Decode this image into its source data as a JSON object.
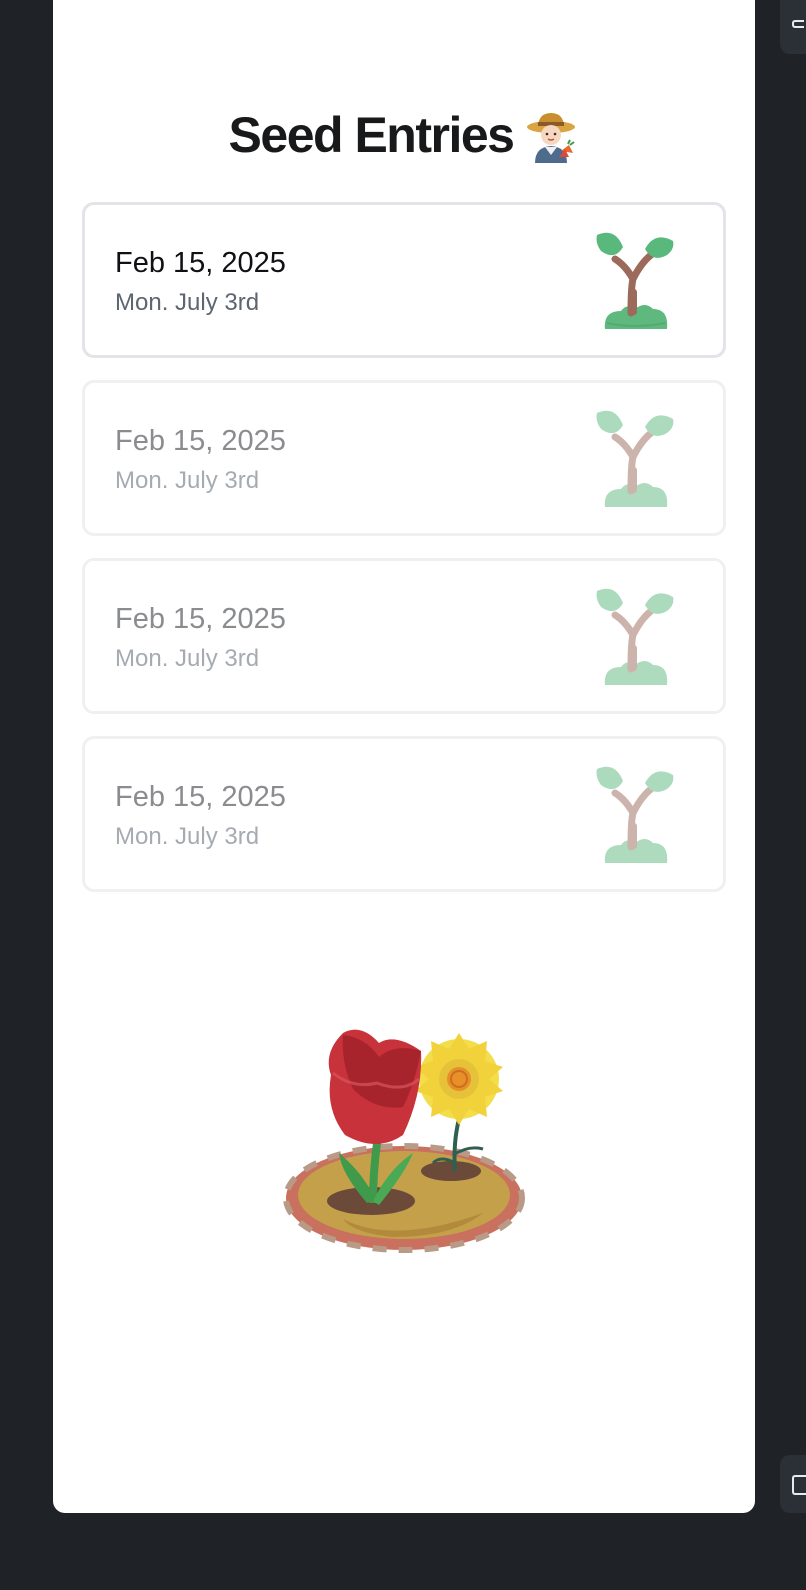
{
  "header": {
    "title": "Seed Entries",
    "title_icon": "farmer-emoji"
  },
  "entries": [
    {
      "date": "Feb 15, 2025",
      "day": "Mon. July 3rd",
      "icon": "sprout-icon",
      "active": true
    },
    {
      "date": "Feb 15, 2025",
      "day": "Mon. July 3rd",
      "icon": "sprout-icon",
      "active": false
    },
    {
      "date": "Feb 15, 2025",
      "day": "Mon. July 3rd",
      "icon": "sprout-icon",
      "active": false
    },
    {
      "date": "Feb 15, 2025",
      "day": "Mon. July 3rd",
      "icon": "sprout-icon",
      "active": false
    }
  ],
  "illustration": "flower-garden-illustration",
  "colors": {
    "background": "#1f2328",
    "panel": "#ffffff",
    "leaf": "#56b57a",
    "stem": "#9b6a5a",
    "tulip": "#c8323a",
    "sunflower": "#f2d23a"
  }
}
